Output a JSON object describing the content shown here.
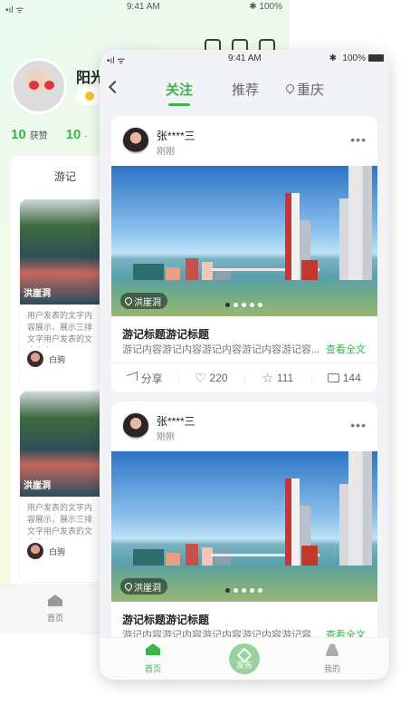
{
  "background_screen": {
    "status": {
      "signal": "•ıl ᯤ",
      "time": "9:41 AM",
      "battery": "✱ 100%"
    },
    "profile": {
      "name": "阳光"
    },
    "stats": [
      {
        "value": "10",
        "label": "获赞"
      },
      {
        "value": "10",
        "label": "·"
      }
    ],
    "tab": "游记",
    "cards": [
      {
        "location": "洪崖洞",
        "desc": "用户发表的文字内容展示，展示三排文字用户发表的文字内容",
        "user": "白驹"
      },
      {
        "location": "洪崖洞",
        "desc": "用户发表的文字内容展示，展示三排文字用户发表的文字内容",
        "user": "白驹"
      }
    ],
    "nav_home": "首页"
  },
  "status_bar": {
    "signal": "•ıl ᯤ",
    "time": "9:41 AM",
    "bluetooth": "✱",
    "battery": "100%"
  },
  "tabs": {
    "follow": "关注",
    "recommend": "推荐",
    "city": "重庆"
  },
  "posts": [
    {
      "user": "张****三",
      "time": "刚刚",
      "location": "洪崖洞",
      "image_pages": 5,
      "current_page": 1,
      "title": "游记标题游记标题",
      "body": "游记内容游记内容游记内容游记内容游记容...",
      "more": "查看全文",
      "actions": {
        "share": "分享",
        "likes": "220",
        "stars": "111",
        "comments": "144"
      }
    },
    {
      "user": "张****三",
      "time": "刚刚",
      "location": "洪崖洞",
      "image_pages": 5,
      "current_page": 1,
      "title": "游记标题游记标题",
      "body": "游记内容游记内容游记内容游记内容游记容...",
      "more": "查看全文"
    }
  ],
  "bottom_nav": {
    "home": "首页",
    "publish": "发布",
    "mine": "我的"
  },
  "colors": {
    "accent": "#3bb44a",
    "background": "#f2f3f6",
    "card": "#ffffff"
  }
}
